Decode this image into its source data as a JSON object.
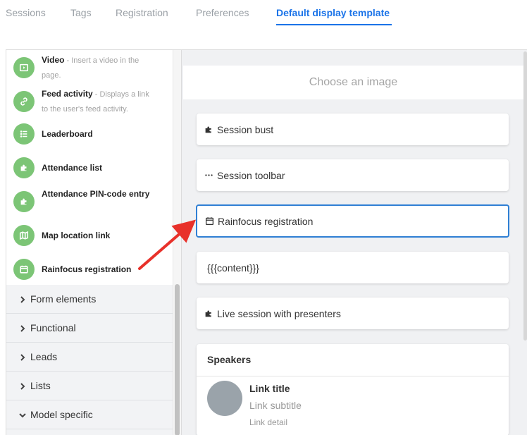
{
  "tabs": [
    {
      "label": "Sessions"
    },
    {
      "label": "Tags"
    },
    {
      "label": "Registration"
    },
    {
      "label": "Preferences"
    },
    {
      "label": "Default display template",
      "active": true
    }
  ],
  "components": [
    {
      "title": "Video",
      "desc": " - Insert a video in the page.",
      "icon": "video-icon"
    },
    {
      "title": "Feed activity",
      "desc": " - Displays a link to the user's feed activity.",
      "icon": "link-icon"
    },
    {
      "title": "Leaderboard",
      "desc": "",
      "icon": "list-icon"
    },
    {
      "title": "Attendance list",
      "desc": "",
      "icon": "puzzle-icon"
    },
    {
      "title": "Attendance PIN-code entry",
      "desc": "",
      "icon": "puzzle-icon"
    },
    {
      "title": "Map location link",
      "desc": "",
      "icon": "map-icon"
    },
    {
      "title": "Rainfocus registration",
      "desc": "",
      "icon": "calendar-icon"
    }
  ],
  "categories": [
    {
      "label": "Form elements",
      "expanded": false
    },
    {
      "label": "Functional",
      "expanded": false
    },
    {
      "label": "Leads",
      "expanded": false
    },
    {
      "label": "Lists",
      "expanded": false
    },
    {
      "label": "Model specific",
      "expanded": true
    }
  ],
  "canvas": {
    "image_placeholder": "Choose an image",
    "blocks": [
      {
        "label": "Session bust",
        "icon": "puzzle-icon"
      },
      {
        "label": "Session toolbar",
        "icon": "ellipsis-icon"
      },
      {
        "label": "Rainfocus registration",
        "icon": "calendar-icon",
        "selected": true
      },
      {
        "label": "{{{content}}}",
        "icon": ""
      },
      {
        "label": "Live session with presenters",
        "icon": "puzzle-icon"
      }
    ],
    "speakers": {
      "header": "Speakers",
      "link_title": "Link title",
      "link_subtitle": "Link subtitle",
      "link_detail": "Link detail"
    }
  },
  "colors": {
    "accent": "#1a73e8",
    "component_icon_bg": "#7cc576",
    "annotation_arrow": "#e8312a"
  }
}
